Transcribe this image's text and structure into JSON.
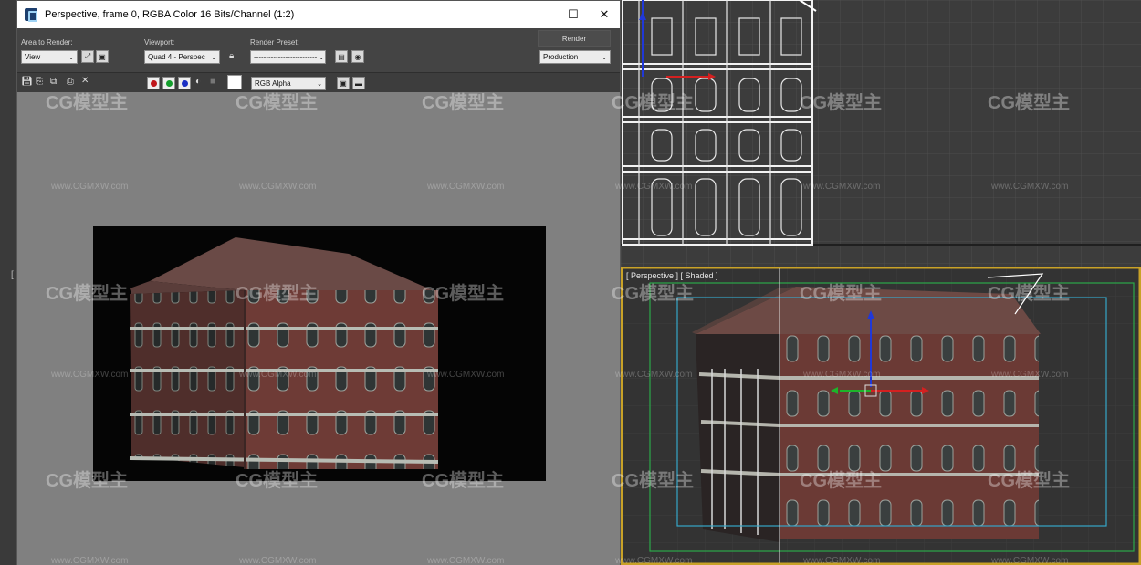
{
  "window": {
    "title": "Perspective, frame 0, RGBA Color 16 Bits/Channel (1:2)",
    "minimize": "—",
    "maximize": "☐",
    "close": "✕"
  },
  "toolbar": {
    "area_label": "Area to Render:",
    "area_value": "View",
    "viewport_label": "Viewport:",
    "viewport_value": "Quad 4 - Perspec",
    "preset_label": "Render Preset:",
    "preset_value": "--------------------------",
    "render_button": "Render",
    "production_value": "Production",
    "channel_value": "RGB Alpha"
  },
  "viewports": {
    "perspective_label": "[ Perspective ] [ Shaded ]"
  },
  "watermark": {
    "logo": "CG模型主",
    "url": "www.CGMXW.com"
  },
  "colors": {
    "red_channel": "#c0161b",
    "green_channel": "#149e2c",
    "blue_channel": "#1a2fc4",
    "viewport_border": "#c9a227"
  },
  "left_strip_glyph": "["
}
